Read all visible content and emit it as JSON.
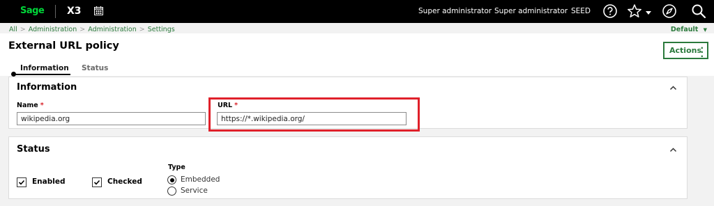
{
  "topbar": {
    "logo": "Sage",
    "product": "X3",
    "user_1": "Super administrator",
    "user_2": "Super administrator",
    "folder": "SEED"
  },
  "breadcrumb": [
    "All",
    "Administration",
    "Administration",
    "Settings"
  ],
  "default_menu": "Default",
  "page": {
    "title": "External URL policy",
    "actions_label": "Actions"
  },
  "tabs": [
    "Information",
    "Status"
  ],
  "information": {
    "title": "Information",
    "name_label": "Name",
    "name_value": "wikipedia.org",
    "url_label": "URL",
    "url_value": "https://*.wikipedia.org/"
  },
  "status": {
    "title": "Status",
    "enabled_label": "Enabled",
    "enabled_checked": true,
    "checked_label": "Checked",
    "checked_checked": true,
    "type_label": "Type",
    "type_options": [
      "Embedded",
      "Service"
    ],
    "type_selected": "Embedded"
  },
  "colors": {
    "brand_green": "#00d639",
    "link_green": "#2b7a3c",
    "required_red": "#d8232a",
    "highlight_red": "#e0202a"
  }
}
